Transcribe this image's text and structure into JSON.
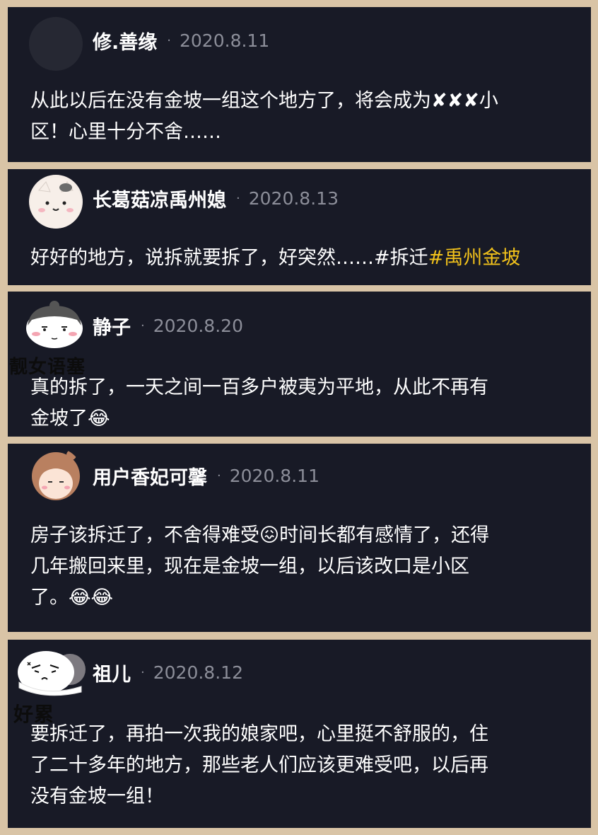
{
  "comments": [
    {
      "user": "修.善缘",
      "separator": "·",
      "date": "2020.8.11",
      "lines": [
        "从此以后在没有金坡一组这个地方了，将会成为✘✘✘小",
        "区！心里十分不舍……"
      ]
    },
    {
      "user": "长葛菇凉禹州媳",
      "separator": "·",
      "date": "2020.8.13",
      "text": "好好的地方，说拆就要拆了，好突然……#拆迁",
      "tag": "#禹州金坡"
    },
    {
      "user": "静子",
      "separator": "·",
      "date": "2020.8.20",
      "sticker_text": "靓女语塞",
      "lines": [
        "真的拆了，一天之间一百多户被夷为平地，从此不再有",
        "金坡了😂"
      ]
    },
    {
      "user": "用户香妃可馨",
      "separator": "·",
      "date": "2020.8.11",
      "lines": [
        "房子该拆迁了，不舍得难受😖时间长都有感情了，还得",
        "几年搬回来里，现在是金坡一组，以后该改口是小区",
        "了。😂😂"
      ]
    },
    {
      "user": "祖儿",
      "separator": "·",
      "date": "2020.8.12",
      "sticker_text": "好累",
      "lines": [
        "要拆迁了，再拍一次我的娘家吧，心里挺不舒服的，住",
        "了二十多年的地方，那些老人们应该更难受吧，以后再",
        "没有金坡一组！"
      ]
    }
  ]
}
